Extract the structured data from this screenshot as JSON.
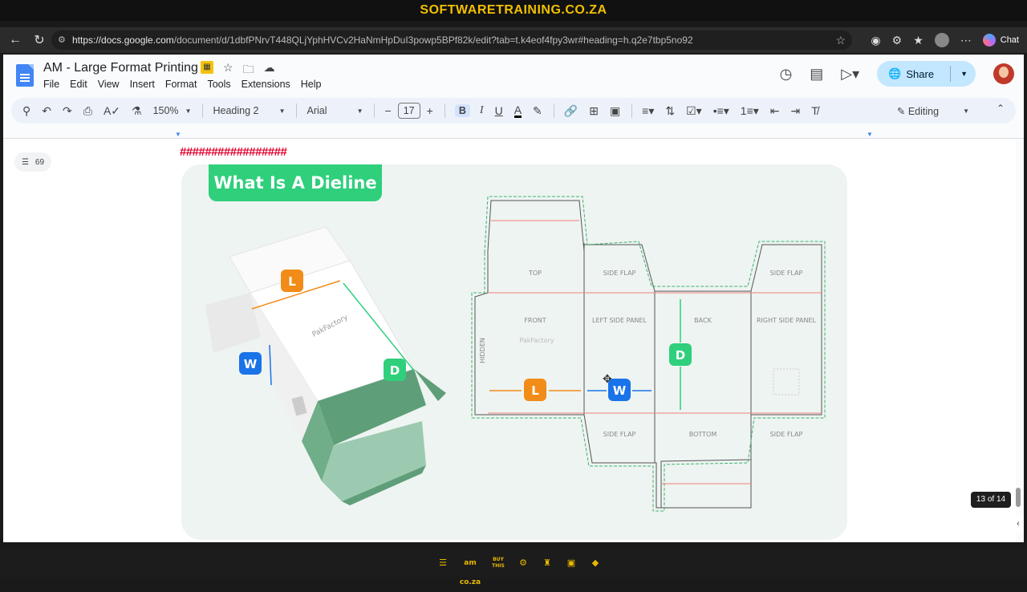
{
  "banner": {
    "text_a": "SOFTWARE",
    "text_b": "TRAINING",
    "text_c": ".CO.ZA"
  },
  "browser": {
    "url_host": "https://docs.google.com",
    "url_path": "/document/d/1dbfPNrvT448QLjYphHVCv2HaNmHpDuI3powp5BPf82k/edit?tab=t.k4eof4fpy3wr#heading=h.q2e7tbp5no92",
    "chat_label": "Chat"
  },
  "doc": {
    "title": "AM - Large Format Printing",
    "menu": [
      "File",
      "Edit",
      "View",
      "Insert",
      "Format",
      "Tools",
      "Extensions",
      "Help"
    ],
    "share_label": "Share"
  },
  "toolbar": {
    "zoom": "150%",
    "style": "Heading 2",
    "font": "Arial",
    "font_size": "17",
    "bold": "B",
    "italic": "I",
    "underline": "U",
    "text_color": "A",
    "mode": "Editing"
  },
  "outline_count": "69",
  "hash_text": "#################",
  "figure": {
    "title": "What Is A Dieline",
    "brand": "PakFactory",
    "panels": {
      "top": "TOP",
      "side_flap": "SIDE FLAP",
      "front": "FRONT",
      "left_side_panel": "LEFT SIDE PANEL",
      "back": "BACK",
      "right_side_panel": "RIGHT SIDE PANEL",
      "bottom": "BOTTOM",
      "hidden": "HIDDEN"
    },
    "labels": {
      "length": "L",
      "width": "W",
      "depth": "D"
    },
    "colors": {
      "green": "#2fcf7c",
      "orange": "#f28c18",
      "blue": "#1a73e8",
      "dieline_red": "#f08080",
      "dieline_green": "#3cb371"
    }
  },
  "page_counter": "13 of 14",
  "taskbar": [
    "am co.za",
    "BUY THIS"
  ]
}
